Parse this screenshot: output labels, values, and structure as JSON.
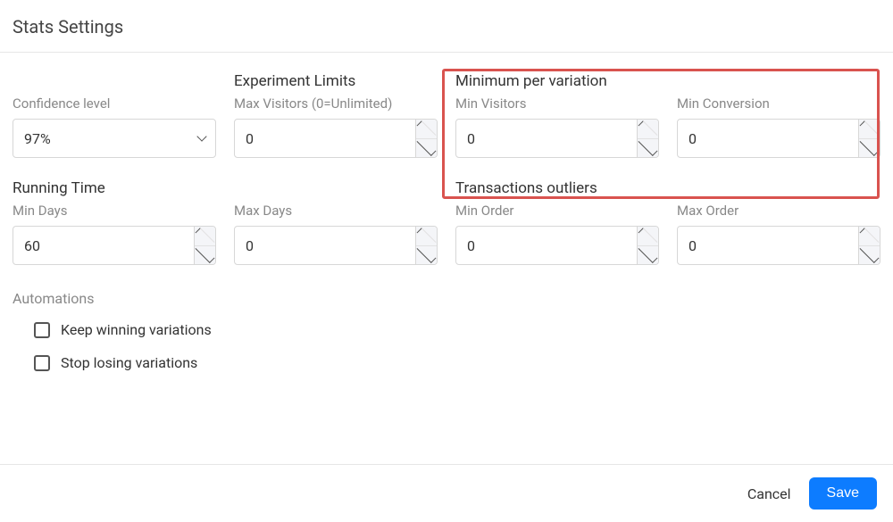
{
  "title": "Stats Settings",
  "sections": {
    "confidence": {
      "label": "Confidence level",
      "value": "97%"
    },
    "experiment_limits": {
      "heading": "Experiment Limits",
      "max_visitors_label": "Max Visitors (0=Unlimited)",
      "max_visitors_value": "0"
    },
    "min_per_variation": {
      "heading": "Minimum per variation",
      "min_visitors_label": "Min Visitors",
      "min_visitors_value": "0",
      "min_conversion_label": "Min Conversion",
      "min_conversion_value": "0"
    },
    "running_time": {
      "heading": "Running Time",
      "min_days_label": "Min Days",
      "min_days_value": "60",
      "max_days_label": "Max Days",
      "max_days_value": "0"
    },
    "transactions_outliers": {
      "heading": "Transactions outliers",
      "min_order_label": "Min Order",
      "min_order_value": "0",
      "max_order_label": "Max Order",
      "max_order_value": "0"
    },
    "automations": {
      "heading": "Automations",
      "keep_winning": "Keep winning variations",
      "stop_losing": "Stop losing variations"
    }
  },
  "footer": {
    "cancel": "Cancel",
    "save": "Save"
  }
}
